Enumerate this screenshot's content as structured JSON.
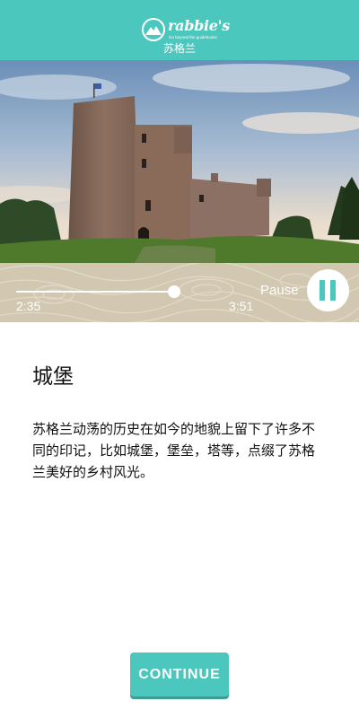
{
  "header": {
    "brand": "rabbie's",
    "tagline": "Go beyond the guidebooks",
    "subtitle": "苏格兰"
  },
  "player": {
    "elapsed": "2:35",
    "total": "3:51",
    "progress": 0.67,
    "pause_label": "Pause"
  },
  "content": {
    "title": "城堡",
    "body": "苏格兰动荡的历史在如今的地貌上留下了许多不同的印记，比如城堡，堡垒，塔等，点缀了苏格兰美好的乡村风光。"
  },
  "actions": {
    "continue_label": "CONTINUE"
  },
  "colors": {
    "accent": "#4cc7bd",
    "player_bg": "#d2c8b2"
  }
}
